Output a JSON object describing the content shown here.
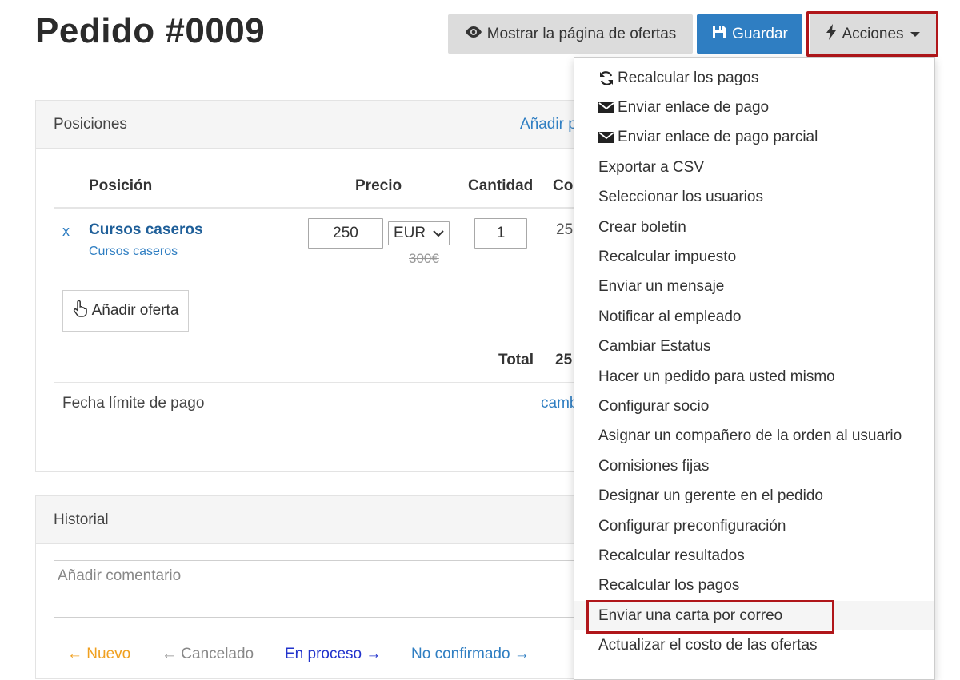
{
  "header": {
    "title": "Pedido #0009",
    "btn_offers": "Mostrar la página de ofertas",
    "btn_save": "Guardar",
    "btn_actions": "Acciones"
  },
  "positions_panel": {
    "title": "Posiciones",
    "add_link": "Añadir p",
    "columns": {
      "position": "Posición",
      "price": "Precio",
      "quantity": "Cantidad",
      "cost": "Co"
    },
    "row": {
      "remove": "x",
      "name": "Cursos caseros",
      "subname": "Cursos caseros",
      "price": "250",
      "currency": "EUR",
      "old_price": "300€",
      "quantity": "1",
      "cost": "25"
    },
    "add_offer": "Añadir oferta",
    "total_label": "Total",
    "total_value": "25",
    "due_label": "Fecha límite de pago",
    "due_link": "camb"
  },
  "history_panel": {
    "title": "Historial",
    "comment_placeholder": "Añadir comentario",
    "statuses": [
      {
        "label": "Nuevo",
        "color": "#f0a020",
        "arrow": "←"
      },
      {
        "label": "Cancelado",
        "color": "#888888",
        "arrow": "←"
      },
      {
        "label": "En proceso",
        "color": "#2233cc",
        "arrow": "→"
      },
      {
        "label": "No confirmado",
        "color": "#2f7ec2",
        "arrow": "→"
      }
    ]
  },
  "actions_menu": {
    "items": [
      {
        "label": "Recalcular los pagos",
        "icon": "refresh-icon"
      },
      {
        "label": "Enviar enlace de pago",
        "icon": "envelope-icon"
      },
      {
        "label": "Enviar enlace de pago parcial",
        "icon": "envelope-icon"
      },
      {
        "label": "Exportar a CSV"
      },
      {
        "label": "Seleccionar los usuarios"
      },
      {
        "label": "Crear boletín"
      },
      {
        "label": "Recalcular impuesto"
      },
      {
        "label": "Enviar un mensaje"
      },
      {
        "label": "Notificar al empleado"
      },
      {
        "label": "Cambiar Estatus"
      },
      {
        "label": "Hacer un pedido para usted mismo"
      },
      {
        "label": "Configurar socio"
      },
      {
        "label": "Asignar un compañero de la orden al usuario"
      },
      {
        "label": "Comisiones fijas"
      },
      {
        "label": "Designar un gerente en el pedido"
      },
      {
        "label": "Configurar preconfiguración"
      },
      {
        "label": "Recalcular resultados"
      },
      {
        "label": "Recalcular los pagos"
      },
      {
        "label": "Enviar una carta por correo",
        "highlighted": true
      },
      {
        "label": "Actualizar el costo de las ofertas"
      }
    ]
  },
  "colors": {
    "primary": "#2f7ec2",
    "highlight_border": "#b0161a"
  }
}
